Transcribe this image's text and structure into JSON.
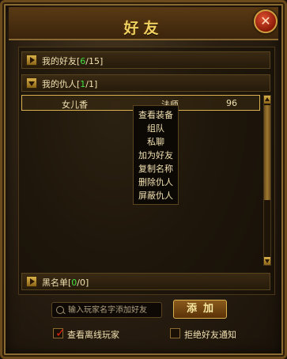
{
  "window": {
    "title": "好友",
    "close_glyph": "✕"
  },
  "groups": {
    "friends": {
      "label": "我的好友",
      "open": "[",
      "current": "6",
      "total": "/15]"
    },
    "enemies": {
      "label": "我的仇人",
      "open": "[",
      "current": "1",
      "total": "/1]"
    },
    "blacklist": {
      "label": "黑名单",
      "open": "[",
      "current": "0",
      "total": "/0]"
    }
  },
  "enemy_list": [
    {
      "name": "女儿香",
      "class": "法师",
      "level": "96"
    }
  ],
  "context_menu": [
    "查看装备",
    "组队",
    "私聊",
    "加为好友",
    "复制名称",
    "删除仇人",
    "屏蔽仇人"
  ],
  "search": {
    "placeholder": "输入玩家名字添加好友",
    "value": ""
  },
  "add_button": "添加",
  "options": {
    "show_offline": {
      "label": "查看离线玩家",
      "checked": true
    },
    "reject_requests": {
      "label": "拒绝好友通知",
      "checked": false
    }
  },
  "colors": {
    "title_gold": "#f0d060",
    "online_count_green": "#40e040",
    "check_red": "#e02010"
  }
}
